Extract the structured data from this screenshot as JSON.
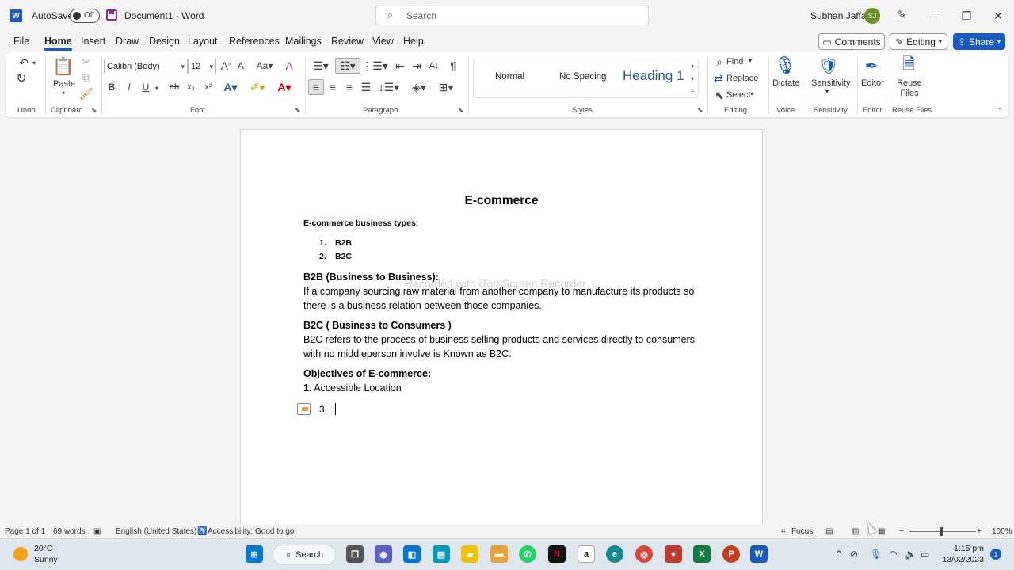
{
  "titlebar": {
    "autosave_label": "AutoSave",
    "autosave_state": "Off",
    "doc_title": "Document1 - Word",
    "search_placeholder": "Search",
    "user_name": "Subhan Jaffar",
    "user_initials": "SJ"
  },
  "menu": {
    "tabs": [
      "File",
      "Home",
      "Insert",
      "Draw",
      "Design",
      "Layout",
      "References",
      "Mailings",
      "Review",
      "View",
      "Help"
    ],
    "active": "Home",
    "comments": "Comments",
    "editing": "Editing",
    "share": "Share"
  },
  "ribbon": {
    "font_name": "Calibri (Body)",
    "font_size": "12",
    "paste": "Paste",
    "styles": [
      "Normal",
      "No Spacing",
      "Heading 1"
    ],
    "find": "Find",
    "replace": "Replace",
    "select": "Select",
    "dictate": "Dictate",
    "sensitivity": "Sensitivity",
    "editor": "Editor",
    "reuse_files": "Reuse Files",
    "groups": {
      "undo": "Undo",
      "clipboard": "Clipboard",
      "font": "Font",
      "paragraph": "Paragraph",
      "styles": "Styles",
      "editing": "Editing",
      "voice": "Voice",
      "sensitivity": "Sensitivity",
      "editor": "Editor",
      "reuse_files": "Reuse Files"
    }
  },
  "document": {
    "title": "E-commerce",
    "types_heading": "E-commerce business types:",
    "types_list": [
      {
        "num": "1.",
        "text": "B2B"
      },
      {
        "num": "2.",
        "text": "B2C"
      }
    ],
    "b2b_heading": "B2B (Business to Business):",
    "b2b_body": "If a company sourcing raw material from another company to manufacture its products so there is a business relation between those companies.",
    "b2c_heading": "B2C ( Business to Consumers )",
    "b2c_body": "B2C refers to the process of business selling products and services directly to consumers with no middleperson involve is Known as B2C.",
    "objectives_heading": "Objectives of E-commerce:",
    "objective_1_num": "1.",
    "objective_1_text": "Accessible Location",
    "current_item_num": "3.",
    "watermark": "Recorded with iTop Screen Recorder"
  },
  "statusbar": {
    "page": "Page 1 of 1",
    "words": "69 words",
    "language": "English (United States)",
    "accessibility": "Accessibility: Good to go",
    "focus": "Focus",
    "zoom": "100%"
  },
  "taskbar": {
    "temperature": "20°C",
    "condition": "Sunny",
    "search": "Search",
    "time": "1:15 pm",
    "date": "13/02/2023",
    "notifications": "1"
  },
  "colors": {
    "accent": "#185abd",
    "heading_blue": "#2f5496"
  }
}
